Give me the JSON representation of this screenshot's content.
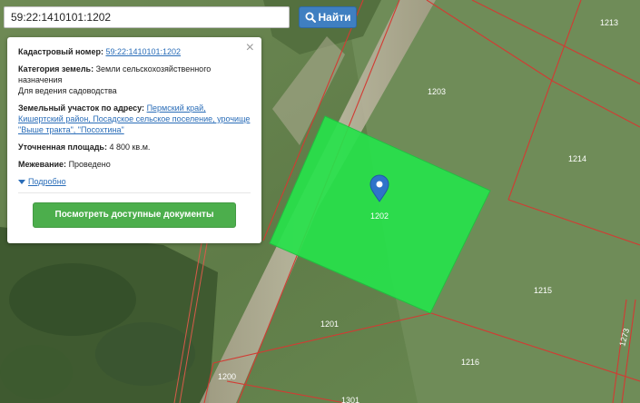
{
  "search": {
    "value": "59:22:1410101:1202",
    "button_label": "Найти",
    "button_icon": "search-icon"
  },
  "info": {
    "cadastral_label": "Кадастровый номер:",
    "cadastral_value": "59:22:1410101:1202",
    "category_label": "Категория земель:",
    "category_value": "Земли сельскохозяйственного назначения",
    "usage": "Для ведения садоводства",
    "address_label": "Земельный участок по адресу:",
    "address_value": "Пермский край, Кишертский район, Посадское сельское поселение, урочище \"Выше тракта\", \"Посохтина\"",
    "area_label": "Уточненная площадь:",
    "area_value": "4 800 кв.м.",
    "survey_label": "Межевание:",
    "survey_value": "Проведено",
    "details_link": "Подробно",
    "docs_button": "Посмотреть доступные документы",
    "close_glyph": "×"
  },
  "map": {
    "parcels": [
      "1203",
      "1213",
      "1214",
      "1215",
      "1216",
      "1201",
      "1200",
      "1202",
      "1273",
      "1301"
    ],
    "colors": {
      "highlight": "#27e24b",
      "boundary": "#d23b33",
      "marker": "#2f73c9"
    },
    "marker_icon": "map-pin-icon"
  }
}
